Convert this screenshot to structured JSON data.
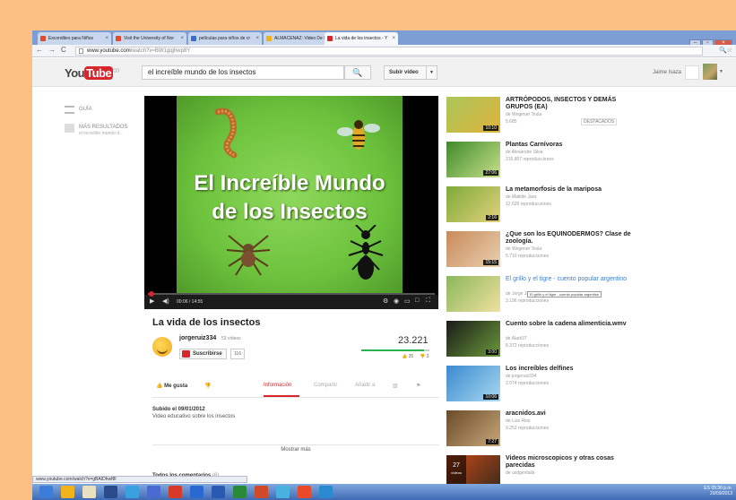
{
  "browser": {
    "tabs": [
      {
        "label": "Escondites para Niños",
        "color": "#e04b2a"
      },
      {
        "label": "Visit the University of Nor",
        "color": "#e04b2a"
      },
      {
        "label": "películas para niños de cr",
        "color": "#3b6cc9"
      },
      {
        "label": "ALMACENAZ: Video De I",
        "color": "#f2b21b"
      },
      {
        "label": "La vida de los insectos - Y",
        "color": "#d8262d"
      }
    ],
    "url_host": "www.youtube.com",
    "url_path": "/watch?v=BW1gqjhwp8Y",
    "status_url": "www.youtube.com/watch?v=gBAIDhwf8I"
  },
  "header": {
    "logo_you": "You",
    "logo_tube": "Tube",
    "logo_suffix": "CO",
    "search_value": "el increíble mundo de los insectos",
    "search_icon": "🔍",
    "upload_label": "Subir vídeo",
    "username": "Jaime Isaza"
  },
  "guide": {
    "guide_label": "GUÍA",
    "more_results_label": "MÁS RESULTADOS",
    "more_results_sub": "el increíble mundo d..."
  },
  "player": {
    "title_line1": "El Increíble Mundo",
    "title_line2": "de los Insectos",
    "time": "00:06 / 14:55",
    "progress": 0.01
  },
  "video": {
    "title": "La vida de los insectos",
    "channel": "jorgeruiz334",
    "channel_videos": "53 vídeos",
    "subscribe_label": "Suscribirse",
    "subscriber_count": "116",
    "views": "23.221",
    "likes": "35",
    "dislikes": "3",
    "like_ratio": 0.92,
    "like_label": "Me gusta",
    "tabs": [
      "Información",
      "Compartir",
      "Añadir a"
    ],
    "published": "Subido el 09/01/2012",
    "description": "Video educativo sobre los insectos",
    "show_more": "Mostrar más",
    "comments_label": "Todos los comentarios",
    "comments_count": "(6)"
  },
  "related": [
    {
      "title": "ARTRÓPODOS, INSECTOS Y DEMÁS GRUPOS (EA)",
      "by": "de Wegener Tesla",
      "views": "5.685",
      "duration": "10:10",
      "badge": "DESTACADOS",
      "colors": [
        "#a9c65a",
        "#e0b33a"
      ]
    },
    {
      "title": "Plantas Carnívoras",
      "by": "de Alexandre Silva",
      "views": "215.807 reproducciones",
      "duration": "27:06",
      "colors": [
        "#3e8a2a",
        "#c8e08a"
      ]
    },
    {
      "title": "La metamorfosis de la mariposa",
      "by": "de Matilde Jara",
      "views": "12.626 reproducciones",
      "duration": "2:16",
      "colors": [
        "#7eaa3a",
        "#e2d27a"
      ]
    },
    {
      "title": "¿Que son los EQUINODERMOS? Clase de zoología.",
      "by": "de Wegener Tesla",
      "views": "5.710 reproducciones",
      "duration": "15:15",
      "colors": [
        "#c98a5a",
        "#e8d0b0"
      ]
    },
    {
      "title": "El grillo y el tigre - cuento popular argentino",
      "by": "de Jorge Jaluff",
      "views": "3.196 reproducciones",
      "duration": "",
      "tooltip": "El grillo y el tigre - cuento popular argentino",
      "colors": [
        "#8ab85a",
        "#f0e0a0"
      ]
    },
    {
      "title": "Cuento sobre la cadena alimenticia.wmv",
      "by": "de Alark37",
      "views": "8.372 reproducciones",
      "duration": "3:00",
      "colors": [
        "#1a1a1a",
        "#6a9a3a"
      ]
    },
    {
      "title": "Los increíbles delfines",
      "by": "de jorgeruiz334",
      "views": "2.074 reproducciones",
      "duration": "10:06",
      "colors": [
        "#3a8ad0",
        "#a8d8f0"
      ]
    },
    {
      "title": "aracnidos.avi",
      "by": "de Luis Rios",
      "views": "9.252 reproducciones",
      "duration": "7:27",
      "colors": [
        "#6a4a2a",
        "#c8a878"
      ]
    },
    {
      "title": "Videos microscopicos y otras cosas parecidas",
      "by": "de usdgentails",
      "views": "",
      "duration": "",
      "playlist_count": "27",
      "playlist_label": "vídeos",
      "colors": [
        "#c84a1a",
        "#3a2a1a"
      ]
    }
  ],
  "taskbar": {
    "time": "05:36 p.m.",
    "date": "20/09/2013",
    "lang": "ES",
    "apps": [
      "#3b7dd8",
      "#f2b21b",
      "#e8e0c0",
      "#2a4a8a",
      "#3ba0e0",
      "#4a6ad0",
      "#d83a2a",
      "#2a6ad0",
      "#2a5ab0",
      "#2a8a3a",
      "#d04a2a",
      "#4ab0e0",
      "#e84a2a",
      "#2a8ad0"
    ]
  }
}
